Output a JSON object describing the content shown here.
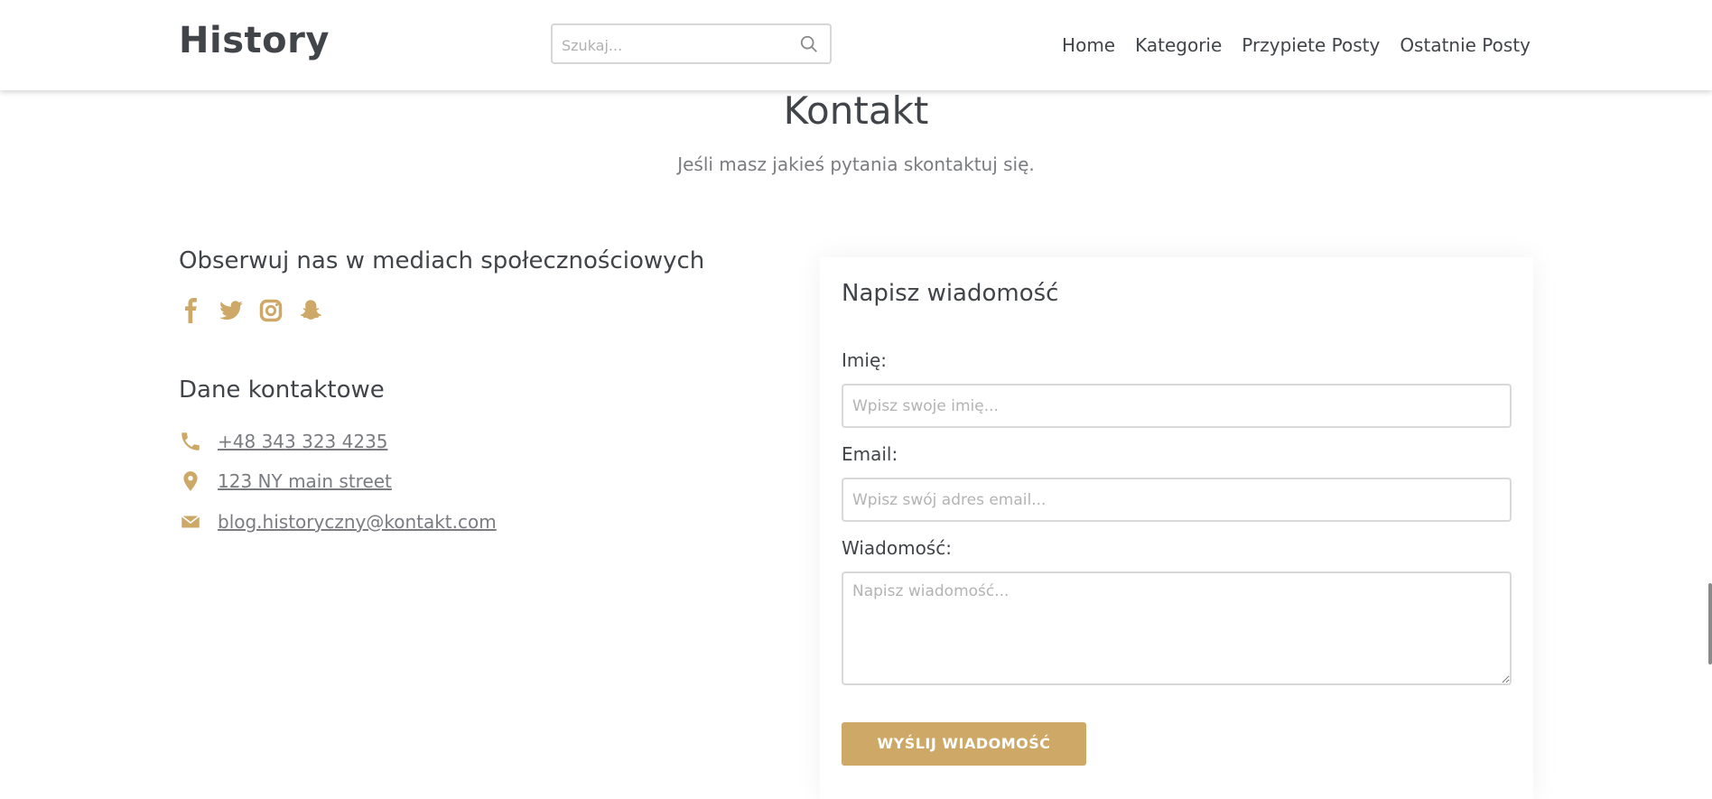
{
  "header": {
    "logo": "History",
    "search_placeholder": "Szukaj...",
    "nav": [
      "Home",
      "Kategorie",
      "Przypiete Posty",
      "Ostatnie Posty"
    ]
  },
  "page": {
    "title": "Kontakt",
    "subtitle": "Jeśli masz jakieś pytania skontaktuj się."
  },
  "social": {
    "heading": "Obserwuj nas w mediach społecznościowych",
    "icons": [
      "facebook-icon",
      "twitter-icon",
      "instagram-icon",
      "snapchat-icon"
    ]
  },
  "contact": {
    "heading": "Dane kontaktowe",
    "phone": "+48 343 323 4235",
    "address": "123 NY main street",
    "email": "blog.historyczny@kontakt.com"
  },
  "form": {
    "title": "Napisz wiadomość",
    "name_label": "Imię:",
    "name_placeholder": "Wpisz swoje imię...",
    "email_label": "Email:",
    "email_placeholder": "Wpisz swój adres email...",
    "message_label": "Wiadomość:",
    "message_placeholder": "Napisz wiadomość...",
    "submit_label": "WYŚLIJ WIADOMOŚĆ"
  },
  "colors": {
    "accent": "#cda866",
    "text": "#414449",
    "muted": "#7a7c80"
  }
}
